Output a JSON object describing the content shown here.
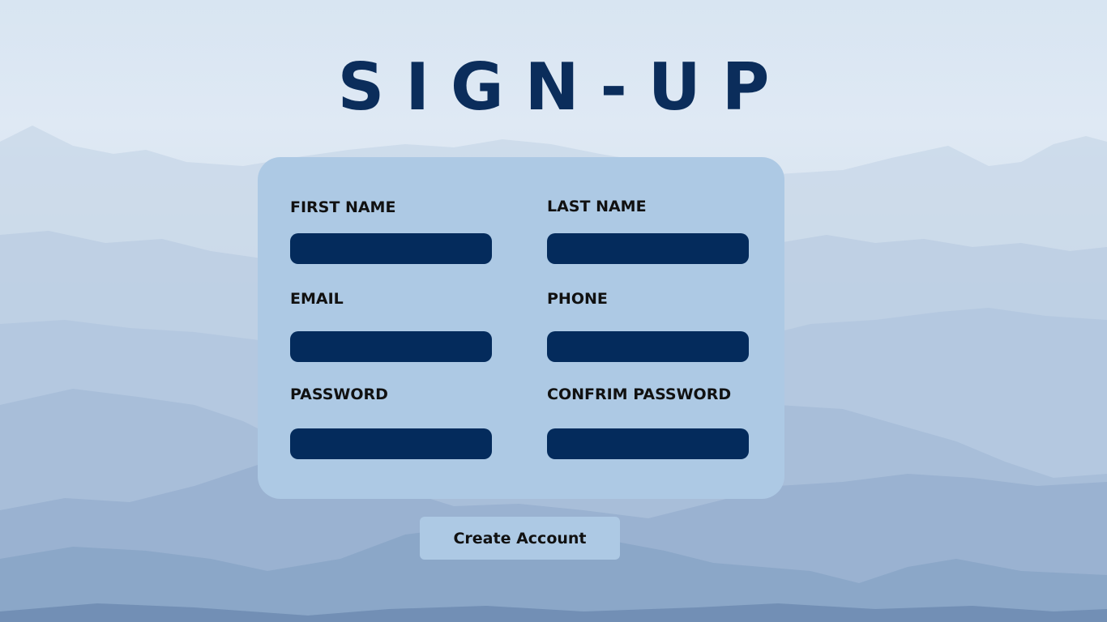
{
  "page": {
    "title": "SIGN-UP"
  },
  "form": {
    "first_name": {
      "label": "FIRST NAME",
      "value": "",
      "placeholder": ""
    },
    "last_name": {
      "label": "LAST NAME",
      "value": "",
      "placeholder": ""
    },
    "email": {
      "label": "EMAIL",
      "value": "",
      "placeholder": ""
    },
    "phone": {
      "label": "PHONE",
      "value": "",
      "placeholder": ""
    },
    "password": {
      "label": "PASSWORD",
      "value": "",
      "placeholder": ""
    },
    "confirm_password": {
      "label": "CONFRIM PASSWORD",
      "value": "",
      "placeholder": ""
    }
  },
  "actions": {
    "create_account_label": "Create Account"
  },
  "colors": {
    "title": "#0b2d5b",
    "card": "#adc9e4",
    "input": "#042b5c",
    "button": "#adc9e4"
  }
}
